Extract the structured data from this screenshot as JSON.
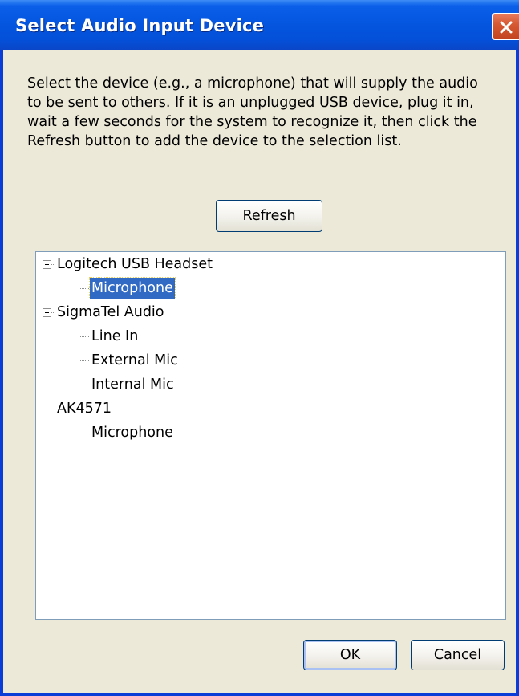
{
  "window": {
    "title": "Select Audio Input Device",
    "title_color": "#ffffff",
    "titlebar_color": "#0556e0",
    "close_button_color": "#d65a34",
    "background_color": "#ece9d8"
  },
  "description": {
    "lines": [
      "Select the device (e.g., a microphone) that will supply the audio",
      "to be sent to others.  If it is an unplugged USB device, plug it in,",
      "wait a few seconds for the system to recognize it, then click the",
      "Refresh button to add the device to the selection list."
    ]
  },
  "buttons": {
    "refresh": "Refresh",
    "ok": "OK",
    "cancel": "Cancel"
  },
  "tree": {
    "devices": [
      {
        "name": "Logitech USB Headset",
        "expanded": true,
        "inputs": [
          {
            "name": "Microphone",
            "selected": true
          }
        ]
      },
      {
        "name": "SigmaTel Audio",
        "expanded": true,
        "inputs": [
          {
            "name": "Line In",
            "selected": false
          },
          {
            "name": "External Mic",
            "selected": false
          },
          {
            "name": "Internal Mic",
            "selected": false
          }
        ]
      },
      {
        "name": "AK4571",
        "expanded": true,
        "inputs": [
          {
            "name": "Microphone",
            "selected": false
          }
        ]
      }
    ],
    "selection_color": "#316ac5",
    "icons": {
      "expander": "collapse-minus-icon",
      "close": "close-x-icon"
    }
  }
}
